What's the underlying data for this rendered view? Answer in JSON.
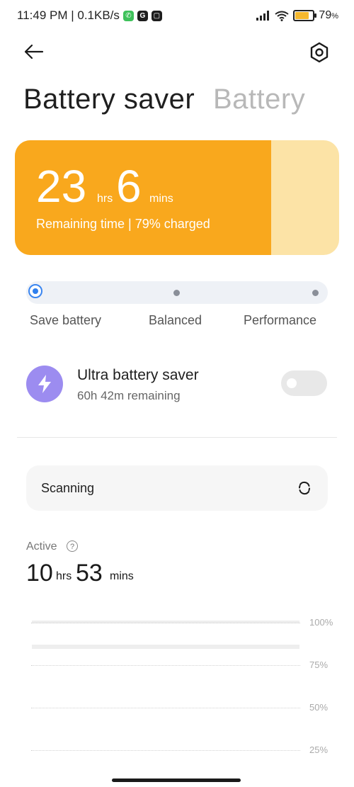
{
  "status_bar": {
    "time_speed": "11:49 PM | 0.1KB/s",
    "battery_percent": "79",
    "battery_percent_suffix": "%",
    "icons": [
      "whatsapp-icon",
      "g-app-icon",
      "chat-app-icon",
      "signal-icon",
      "wifi-icon",
      "battery-icon"
    ]
  },
  "header": {
    "tab_active": "Battery saver",
    "tab_inactive": "Battery",
    "back_icon": "arrow-left-icon",
    "settings_icon": "settings-hex-icon"
  },
  "remaining_card": {
    "hours": "23",
    "hours_unit": "hrs",
    "minutes": "6",
    "minutes_unit": "mins",
    "subtitle": "Remaining time | 79% charged",
    "charge_level": 0.79,
    "colors": {
      "fill": "#f9a81d",
      "empty": "#fce3a6"
    }
  },
  "mode_selector": {
    "options": [
      "Save battery",
      "Balanced",
      "Performance"
    ],
    "selected": "Save battery"
  },
  "ultra_saver": {
    "title": "Ultra battery saver",
    "subtitle": "60h 42m remaining",
    "enabled": false,
    "icon": "lightning-bolt-icon"
  },
  "scan": {
    "label": "Scanning",
    "icon": "refresh-spinner-icon"
  },
  "active": {
    "label": "Active",
    "help_icon": "question-circle-icon",
    "hours": "10",
    "hours_unit": "hrs",
    "minutes": "53",
    "minutes_unit": "mins"
  },
  "usage_chart": {
    "y_labels": [
      "100%",
      "75%",
      "50%",
      "25%"
    ]
  }
}
